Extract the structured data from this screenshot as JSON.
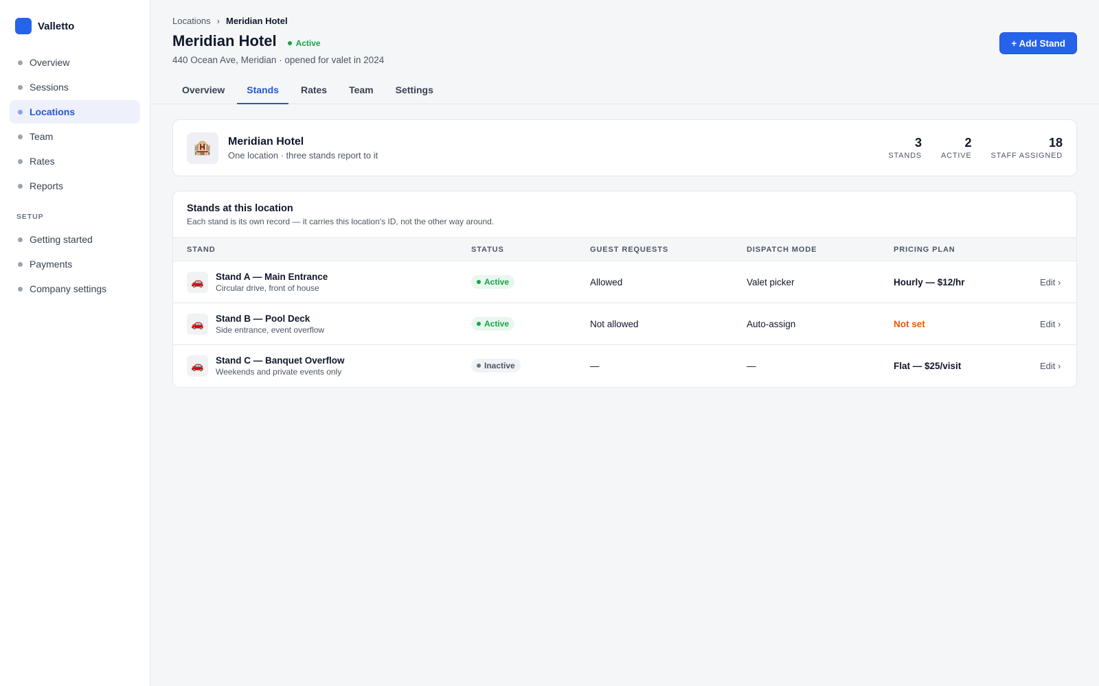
{
  "brand": {
    "name": "Valletto",
    "color": "#2563eb"
  },
  "sidebar": {
    "items": [
      {
        "label": "Overview"
      },
      {
        "label": "Sessions"
      },
      {
        "label": "Locations"
      },
      {
        "label": "Team"
      },
      {
        "label": "Rates"
      },
      {
        "label": "Reports"
      }
    ],
    "section_label": "SETUP",
    "setup_items": [
      {
        "label": "Getting started"
      },
      {
        "label": "Payments"
      },
      {
        "label": "Company settings"
      }
    ]
  },
  "breadcrumb": {
    "parent": "Locations",
    "separator": "›",
    "current": "Meridian Hotel"
  },
  "page": {
    "title": "Meridian Hotel",
    "status": "Active",
    "subtitle": "440 Ocean Ave, Meridian · opened for valet in 2024",
    "add_button": "+ Add Stand"
  },
  "tabs": [
    {
      "label": "Overview"
    },
    {
      "label": "Stands"
    },
    {
      "label": "Rates"
    },
    {
      "label": "Team"
    },
    {
      "label": "Settings"
    }
  ],
  "location_card": {
    "icon": "🏨",
    "name": "Meridian Hotel",
    "description": "One location · three stands report to it",
    "stats": [
      {
        "value": "3",
        "label": "STANDS"
      },
      {
        "value": "2",
        "label": "ACTIVE"
      },
      {
        "value": "18",
        "label": "STAFF ASSIGNED"
      }
    ]
  },
  "stands": {
    "title": "Stands at this location",
    "subtitle": "Each stand is its own record — it carries this location's ID, not the other way around.",
    "columns": [
      "STAND",
      "STATUS",
      "GUEST REQUESTS",
      "DISPATCH MODE",
      "PRICING PLAN"
    ],
    "rows": [
      {
        "icon": "🚗",
        "name": "Stand A — Main Entrance",
        "description": "Circular drive, front of house",
        "status": "Active",
        "guest_requests": "Allowed",
        "dispatch_mode": "Valet picker",
        "pricing_plan": "Hourly — $12/hr",
        "edit": "Edit ›"
      },
      {
        "icon": "🚗",
        "name": "Stand B — Pool Deck",
        "description": "Side entrance, event overflow",
        "status": "Active",
        "guest_requests": "Not allowed",
        "dispatch_mode": "Auto-assign",
        "pricing_plan": "Not set",
        "edit": "Edit ›"
      },
      {
        "icon": "🚗",
        "name": "Stand C — Banquet Overflow",
        "description": "Weekends and private events only",
        "status": "Inactive",
        "guest_requests": "—",
        "dispatch_mode": "—",
        "pricing_plan": "Flat — $25/visit",
        "edit": "Edit ›"
      }
    ]
  },
  "colors": {
    "accent": "#2456d6",
    "active_status": "#16a34a",
    "warning": "#ea580c"
  }
}
